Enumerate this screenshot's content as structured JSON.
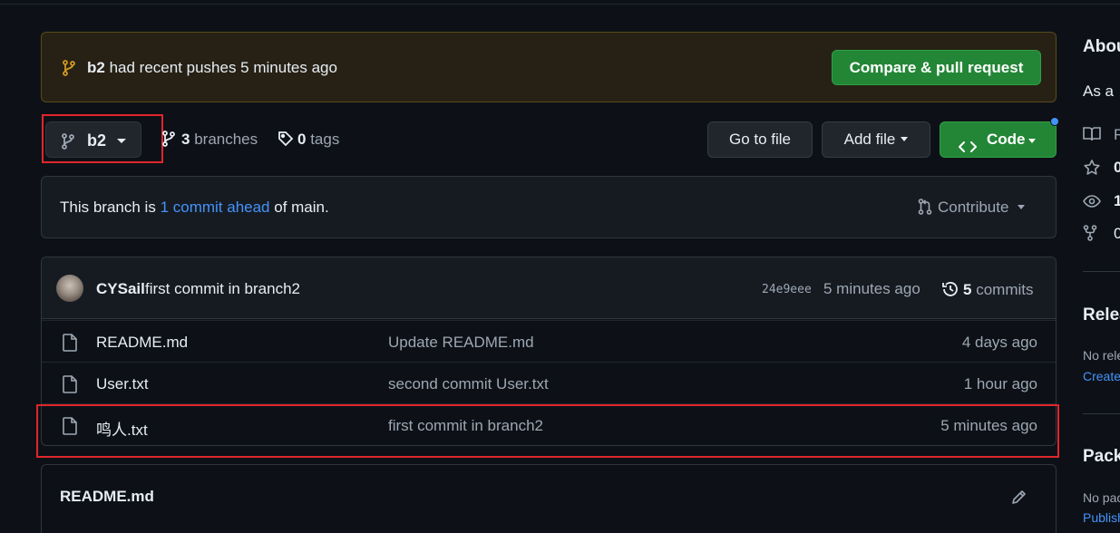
{
  "banner": {
    "branch": "b2",
    "message": "had recent pushes 5 minutes ago",
    "compare_label": "Compare & pull request"
  },
  "toolbar": {
    "branch_label": "b2",
    "branches_count": "3",
    "branches_label": "branches",
    "tags_count": "0",
    "tags_label": "tags",
    "goto_file_label": "Go to file",
    "add_file_label": "Add file",
    "code_label": "Code"
  },
  "ahead": {
    "prefix": "This branch is",
    "link": "1 commit ahead",
    "suffix": "of main.",
    "contribute_label": "Contribute"
  },
  "latest_commit": {
    "author": "CYSail",
    "message": "first commit in branch2",
    "sha": "24e9eee",
    "time": "5 minutes ago",
    "commits_count": "5",
    "commits_label": "commits"
  },
  "files": [
    {
      "name": "README.md",
      "message": "Update README.md",
      "time": "4 days ago"
    },
    {
      "name": "User.txt",
      "message": "second commit User.txt",
      "time": "1 hour ago"
    },
    {
      "name": "鸣人.txt",
      "message": "first commit in branch2",
      "time": "5 minutes ago"
    }
  ],
  "readme": {
    "title": "README.md"
  },
  "sidebar": {
    "about_heading": "About",
    "description": "As a",
    "readme_row": "R",
    "stars_value": "0",
    "watchers_value": "1",
    "forks_value": "0",
    "releases_heading": "Releases",
    "releases_text": "No releases",
    "releases_link": "Create",
    "packages_heading": "Packages",
    "packages_text": "No packages",
    "packages_link": "Publish"
  },
  "colors": {
    "accent_green": "#238636",
    "link_blue": "#4493f8",
    "highlight_red": "#e0262b",
    "banner_icon": "#d29922"
  },
  "icons": [
    "git-branch-icon",
    "tag-icon",
    "code-icon",
    "git-pull-request-icon",
    "history-icon",
    "file-icon",
    "pencil-icon",
    "book-icon",
    "star-icon",
    "eye-icon",
    "repo-forked-icon"
  ]
}
